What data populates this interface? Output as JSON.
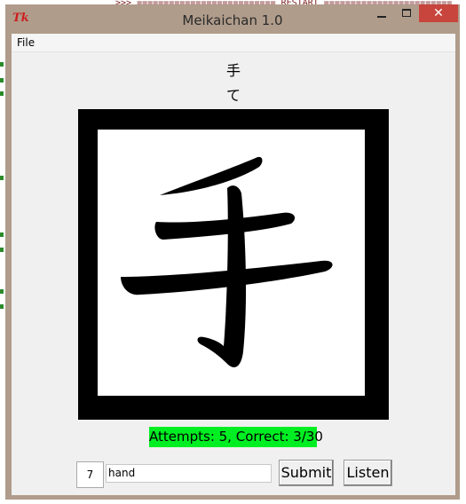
{
  "window": {
    "title": "Meikaichan 1.0",
    "icon_text": "Tk",
    "close_glyph": "✕"
  },
  "menu": {
    "file_label": "File"
  },
  "card": {
    "kanji": "手",
    "reading": "て"
  },
  "status": {
    "text": "Attempts: 5,  Correct: 3/30",
    "color": "#00ee22"
  },
  "controls": {
    "count_value": "7",
    "answer_value": "hand",
    "submit_label": "Submit",
    "listen_label": "Listen"
  },
  "background": {
    "shell_line": ">>> ========================== RESTART ========================"
  }
}
